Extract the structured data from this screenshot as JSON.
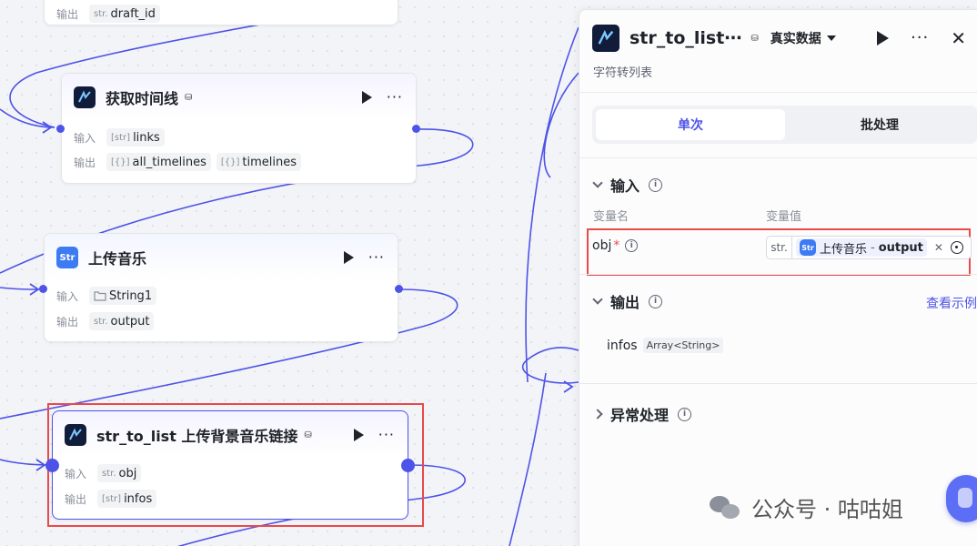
{
  "nodes": {
    "top": {
      "out_label": "输出",
      "out_type": "str.",
      "out_value": "draft_id"
    },
    "timeline": {
      "title": "获取时间线",
      "in_label": "输入",
      "in_type": "[str]",
      "in_value": "links",
      "out_label": "输出",
      "outputs": [
        {
          "type": "[{}]",
          "value": "all_timelines"
        },
        {
          "type": "[{}]",
          "value": "timelines"
        }
      ]
    },
    "upload_music": {
      "title": "上传音乐",
      "icon_text": "Str",
      "in_label": "输入",
      "in_value": "String1",
      "out_label": "输出",
      "out_type": "str.",
      "out_value": "output"
    },
    "str_to_list": {
      "title": "str_to_list 上传背景音乐链接",
      "in_label": "输入",
      "in_type": "str.",
      "in_value": "obj",
      "out_label": "输出",
      "out_type": "[str]",
      "out_value": "infos"
    }
  },
  "panel": {
    "title": "str_to_list⋯",
    "data_mode": "真实数据",
    "subtitle": "字符转列表",
    "tabs": [
      {
        "label": "单次",
        "active": true
      },
      {
        "label": "批处理",
        "active": false
      }
    ],
    "input_section": "输入",
    "col_name": "变量名",
    "col_value": "变量值",
    "var_name": "obj",
    "var_required": "*",
    "var_type": "str.",
    "var_ref_node": "上传音乐",
    "var_ref_sep": "-",
    "var_ref_field": "output",
    "var_ref_icon": "Str",
    "output_section": "输出",
    "view_example": "查看示例",
    "output_name": "infos",
    "output_type": "Array<String>",
    "error_section": "异常处理"
  },
  "watermark": {
    "text": "公众号 · 咕咕姐"
  },
  "colors": {
    "accent": "#4d53e8",
    "highlight": "#e94a4a"
  }
}
